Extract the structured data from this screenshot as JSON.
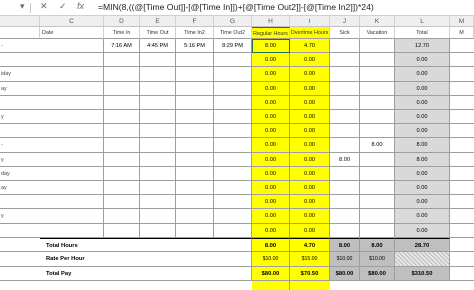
{
  "formula_bar": {
    "name_box_arrow": "▾",
    "close_icon": "✕",
    "check_icon": "✓",
    "fx_label": "fx",
    "formula": "=MIN(8,((@[Time Out]]-[@[Time In]])+[@[Time Out2]]-[@[Time In2]])*24)"
  },
  "columns": [
    "Date",
    "Time In",
    "Time Out",
    "Time In2",
    "Time Out2",
    "Regular Hours",
    "Overtime Hours",
    "Sick",
    "Vacation",
    "Total",
    "M"
  ],
  "col_letters": [
    "",
    "C",
    "D",
    "E",
    "F",
    "G",
    "H",
    "I",
    "J",
    "K",
    "L",
    "M"
  ],
  "rows": [
    {
      "label": "-",
      "date": "",
      "time_in": "7:16 AM",
      "time_out": "4:45 PM",
      "time_in2": "5:16 PM",
      "time_out2": "8:29 PM",
      "regular": "8.00",
      "overtime": "4.70",
      "sick": "",
      "vacation": "",
      "total": "12.70"
    },
    {
      "label": "",
      "date": "",
      "time_in": "",
      "time_out": "",
      "time_in2": "",
      "time_out2": "",
      "regular": "0.00",
      "overtime": "0.00",
      "sick": "",
      "vacation": "",
      "total": "0.00"
    },
    {
      "label": "iday",
      "date": "",
      "time_in": "",
      "time_out": "",
      "time_in2": "",
      "time_out2": "",
      "regular": "0.00",
      "overtime": "0.00",
      "sick": "",
      "vacation": "",
      "total": "0.00"
    },
    {
      "label": "ay",
      "date": "",
      "time_in": "",
      "time_out": "",
      "time_in2": "",
      "time_out2": "",
      "regular": "0.00",
      "overtime": "0.00",
      "sick": "",
      "vacation": "",
      "total": "0.00"
    },
    {
      "label": "",
      "date": "",
      "time_in": "",
      "time_out": "",
      "time_in2": "",
      "time_out2": "",
      "regular": "0.00",
      "overtime": "0.00",
      "sick": "",
      "vacation": "",
      "total": "0.00"
    },
    {
      "label": "y",
      "date": "",
      "time_in": "",
      "time_out": "",
      "time_in2": "",
      "time_out2": "",
      "regular": "0.00",
      "overtime": "0.00",
      "sick": "",
      "vacation": "",
      "total": "0.00"
    },
    {
      "label": "",
      "date": "",
      "time_in": "",
      "time_out": "",
      "time_in2": "",
      "time_out2": "",
      "regular": "0.00",
      "overtime": "0.00",
      "sick": "",
      "vacation": "",
      "total": "0.00"
    },
    {
      "label": "-",
      "date": "",
      "time_in": "",
      "time_out": "",
      "time_in2": "",
      "time_out2": "",
      "regular": "0.00",
      "overtime": "0.00",
      "sick": "",
      "vacation": "8.00",
      "total": "8.00"
    },
    {
      "label": "y",
      "date": "",
      "time_in": "",
      "time_out": "",
      "time_in2": "",
      "time_out2": "",
      "regular": "0.00",
      "overtime": "0.00",
      "sick": "8.00",
      "vacation": "",
      "total": "8.00"
    },
    {
      "label": "day",
      "date": "",
      "time_in": "",
      "time_out": "",
      "time_in2": "",
      "time_out2": "",
      "regular": "0.00",
      "overtime": "0.00",
      "sick": "",
      "vacation": "",
      "total": "0.00"
    },
    {
      "label": "ay",
      "date": "",
      "time_in": "",
      "time_out": "",
      "time_in2": "",
      "time_out2": "",
      "regular": "0.00",
      "overtime": "0.00",
      "sick": "",
      "vacation": "",
      "total": "0.00"
    },
    {
      "label": "",
      "date": "",
      "time_in": "",
      "time_out": "",
      "time_in2": "",
      "time_out2": "",
      "regular": "0.00",
      "overtime": "0.00",
      "sick": "",
      "vacation": "",
      "total": "0.00"
    },
    {
      "label": "y",
      "date": "",
      "time_in": "",
      "time_out": "",
      "time_in2": "",
      "time_out2": "",
      "regular": "0.00",
      "overtime": "0.00",
      "sick": "",
      "vacation": "",
      "total": "0.00"
    },
    {
      "label": "",
      "date": "",
      "time_in": "",
      "time_out": "",
      "time_in2": "",
      "time_out2": "",
      "regular": "0.00",
      "overtime": "0.00",
      "sick": "",
      "vacation": "",
      "total": "0.00"
    }
  ],
  "summary": {
    "total_hours": {
      "label": "Total Hours",
      "regular": "8.00",
      "overtime": "4.70",
      "sick": "8.00",
      "vacation": "8.00",
      "total": "28.70"
    },
    "rate": {
      "label": "Rate Per Hour",
      "regular": "$10.00",
      "overtime": "$15.00",
      "sick": "$10.00",
      "vacation": "$10.00",
      "total": ""
    },
    "pay": {
      "label": "Total Pay",
      "regular": "$80.00",
      "overtime": "$70.50",
      "sick": "$80.00",
      "vacation": "$80.00",
      "total": "$310.50"
    }
  },
  "colors": {
    "highlight": "#ffff00",
    "selection": "#217346",
    "summary_gray": "#bfbfbf"
  }
}
